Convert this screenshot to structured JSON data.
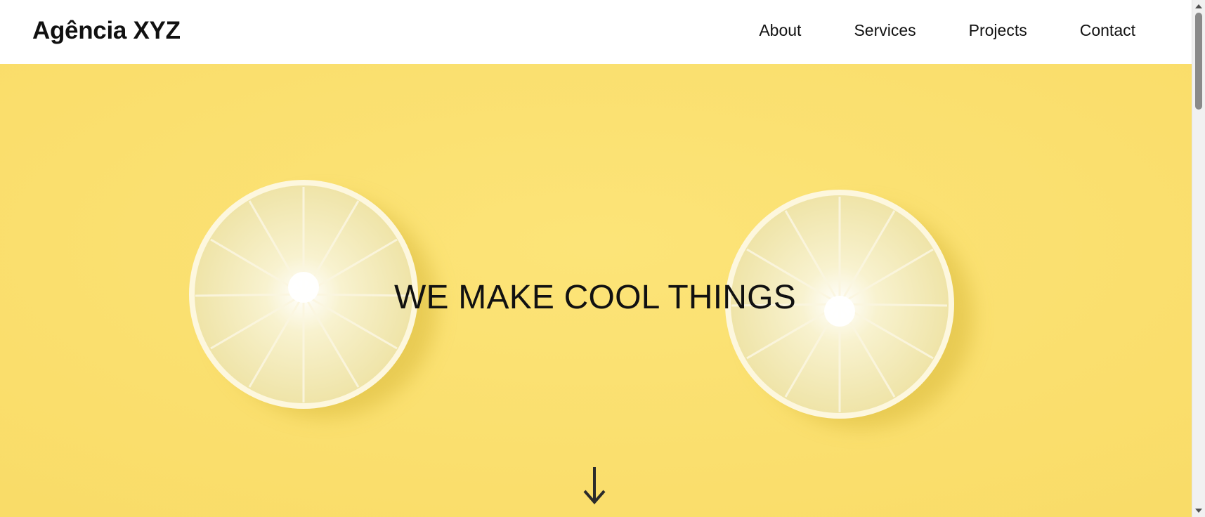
{
  "header": {
    "brand": "Agência XYZ",
    "nav": [
      "About",
      "Services",
      "Projects",
      "Contact"
    ]
  },
  "hero": {
    "title": "WE MAKE COOL THINGS",
    "background_color": "#fbe070",
    "image_subject": "two lemon slices on yellow background",
    "scroll_icon": "arrow-down-icon"
  },
  "colors": {
    "text": "#111111",
    "header_bg": "#ffffff"
  }
}
